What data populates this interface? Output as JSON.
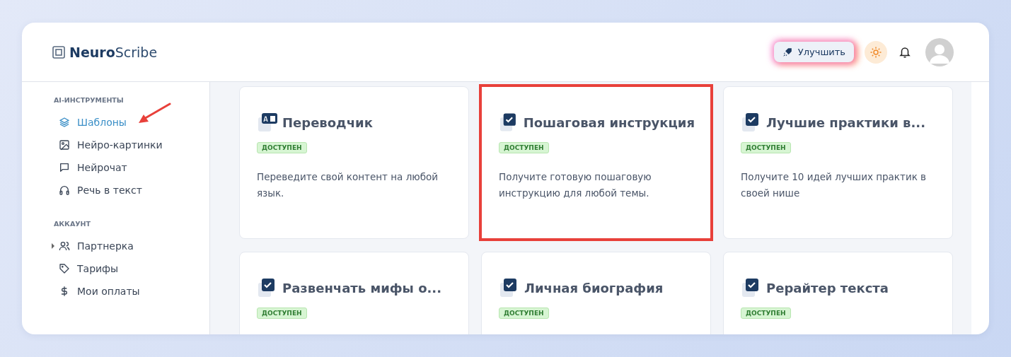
{
  "brand": {
    "bold": "Neuro",
    "rest": "Scribe"
  },
  "header": {
    "upgrade_label": "Улучшить"
  },
  "sidebar": {
    "sections": [
      {
        "title": "AI-ИНСТРУМЕНТЫ",
        "items": [
          {
            "label": "Шаблоны",
            "selected": true,
            "pointed": true,
            "expandable": false
          },
          {
            "label": "Нейро-картинки",
            "selected": false,
            "pointed": false,
            "expandable": false
          },
          {
            "label": "Нейрочат",
            "selected": false,
            "pointed": false,
            "expandable": false
          },
          {
            "label": "Речь в текст",
            "selected": false,
            "pointed": false,
            "expandable": false
          }
        ]
      },
      {
        "title": "АККАУНТ",
        "items": [
          {
            "label": "Партнерка",
            "selected": false,
            "pointed": false,
            "expandable": true
          },
          {
            "label": "Тарифы",
            "selected": false,
            "pointed": false,
            "expandable": false
          },
          {
            "label": "Мои оплаты",
            "selected": false,
            "pointed": false,
            "expandable": false
          }
        ]
      }
    ]
  },
  "cards": [
    {
      "title": "Переводчик",
      "kind": "translate",
      "badge": "ДОСТУПЕН",
      "description": "Переведите свой контент на любой язык.",
      "highlighted": false
    },
    {
      "title": "Пошаговая инструкция",
      "kind": "checklist",
      "badge": "ДОСТУПЕН",
      "description": "Получите готовую пошаговую инструкцию для любой темы.",
      "highlighted": true
    },
    {
      "title": "Лучшие практики в...",
      "kind": "checklist",
      "badge": "ДОСТУПЕН",
      "description": "Получите 10 идей лучших практик в своей нише",
      "highlighted": false
    },
    {
      "title": "Развенчать мифы о...",
      "kind": "checklist",
      "badge": "ДОСТУПЕН",
      "highlighted": false
    },
    {
      "title": "Личная биография",
      "kind": "checklist",
      "badge": "ДОСТУПЕН",
      "highlighted": false
    },
    {
      "title": "Рерайтер текста",
      "kind": "checklist",
      "badge": "ДОСТУПЕН",
      "highlighted": false
    }
  ]
}
